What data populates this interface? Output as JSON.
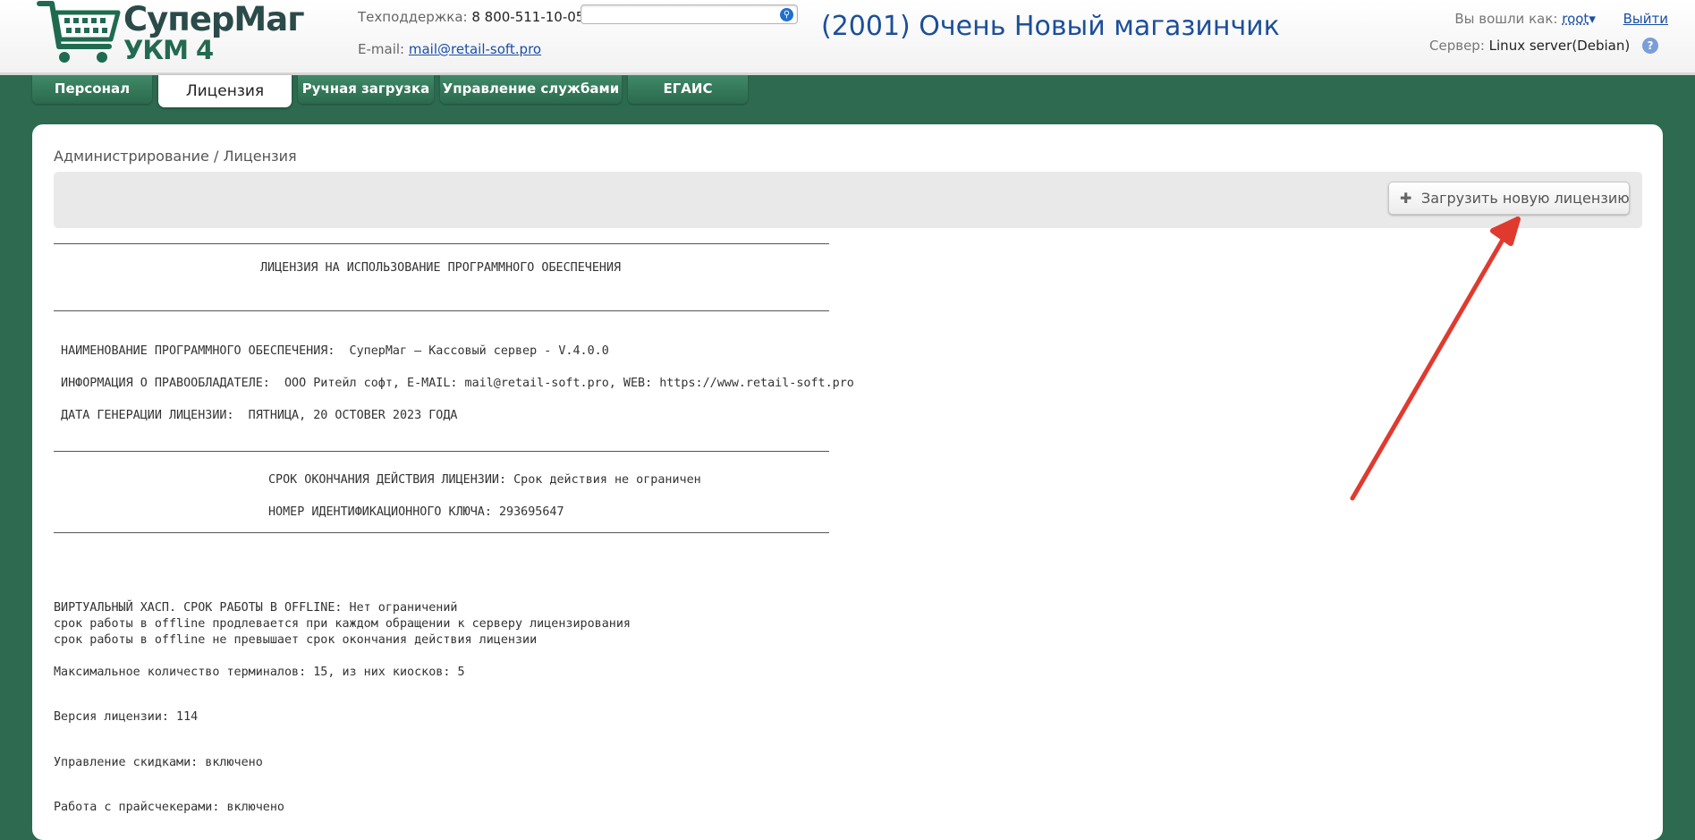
{
  "header": {
    "logo_name": "СуперМаг",
    "logo_sub": "УКМ 4",
    "support_label": "Техподдержка:",
    "support_phone": "8 800-511-10-05",
    "email_label": "E-mail:",
    "email": "mail@retail-soft.pro",
    "search_placeholder": "",
    "search_icon": "search-icon",
    "store_title": "(2001) Очень Новый магазинчик",
    "login_label": "Вы вошли как:",
    "user": "root",
    "user_caret": "▾",
    "exit": "Выйти",
    "server_label": "Сервер:",
    "server_value": "Linux server(Debian)",
    "help": "?"
  },
  "tabs": [
    {
      "label": "Персонал"
    },
    {
      "label": "Лицензия",
      "active": true
    },
    {
      "label": "Ручная загрузка"
    },
    {
      "label": "Управление службами"
    },
    {
      "label": "ЕГАИС"
    }
  ],
  "breadcrumb": "Администрирование  /  Лицензия",
  "toolbar": {
    "upload_icon": "plus-icon",
    "upload_label": "Загрузить новую лицензию"
  },
  "license": {
    "heading": "ЛИЦЕНЗИЯ НА ИСПОЛЬЗОВАНИЕ ПРОГРАММНОГО ОБЕСПЕЧЕНИЯ",
    "software": " НАИМЕНОВАНИЕ ПРОГРАММНОГО ОБЕСПЕЧЕНИЯ:  СуперМаг — Кассовый сервер - V.4.0.0",
    "owner": " ИНФОРМАЦИЯ О ПРАВООБЛАДАТЕЛЕ:  ООО Ритейл софт, E-MAIL: mail@retail-soft.pro, WEB: https://www.retail-soft.pro",
    "gen_date": " ДАТА ГЕНЕРАЦИИ ЛИЦЕНЗИИ:  ПЯТНИЦА, 20 OCTOBER 2023 ГОДА",
    "expiry": "СРОК ОКОНЧАНИЯ ДЕЙСТВИЯ ЛИЦЕНЗИИ: Срок действия не ограничен",
    "key": "НОМЕР ИДЕНТИФИКАЦИОННОГО КЛЮЧА: 293695647",
    "hasp1": "ВИРТУАЛЬНЫЙ ХАСП. СРОК РАБОТЫ В OFFLINE: Нет ограничений",
    "hasp2": "срок работы в offline продлевается при каждом обращении к серверу лицензирования",
    "hasp3": "срок работы в offline не превышает срок окончания действия лицензии",
    "terminals": "Максимальное количество терминалов: 15, из них киосков: 5",
    "version": "Версия лицензии: 114",
    "discounts": "Управление скидками: включено",
    "pricecheckers": "Работа с прайсчекерами: включено"
  },
  "colors": {
    "background": "#2d6a50",
    "tab": "#357a5a",
    "title": "#1c4f9a",
    "arrow": "#e03a2f"
  }
}
